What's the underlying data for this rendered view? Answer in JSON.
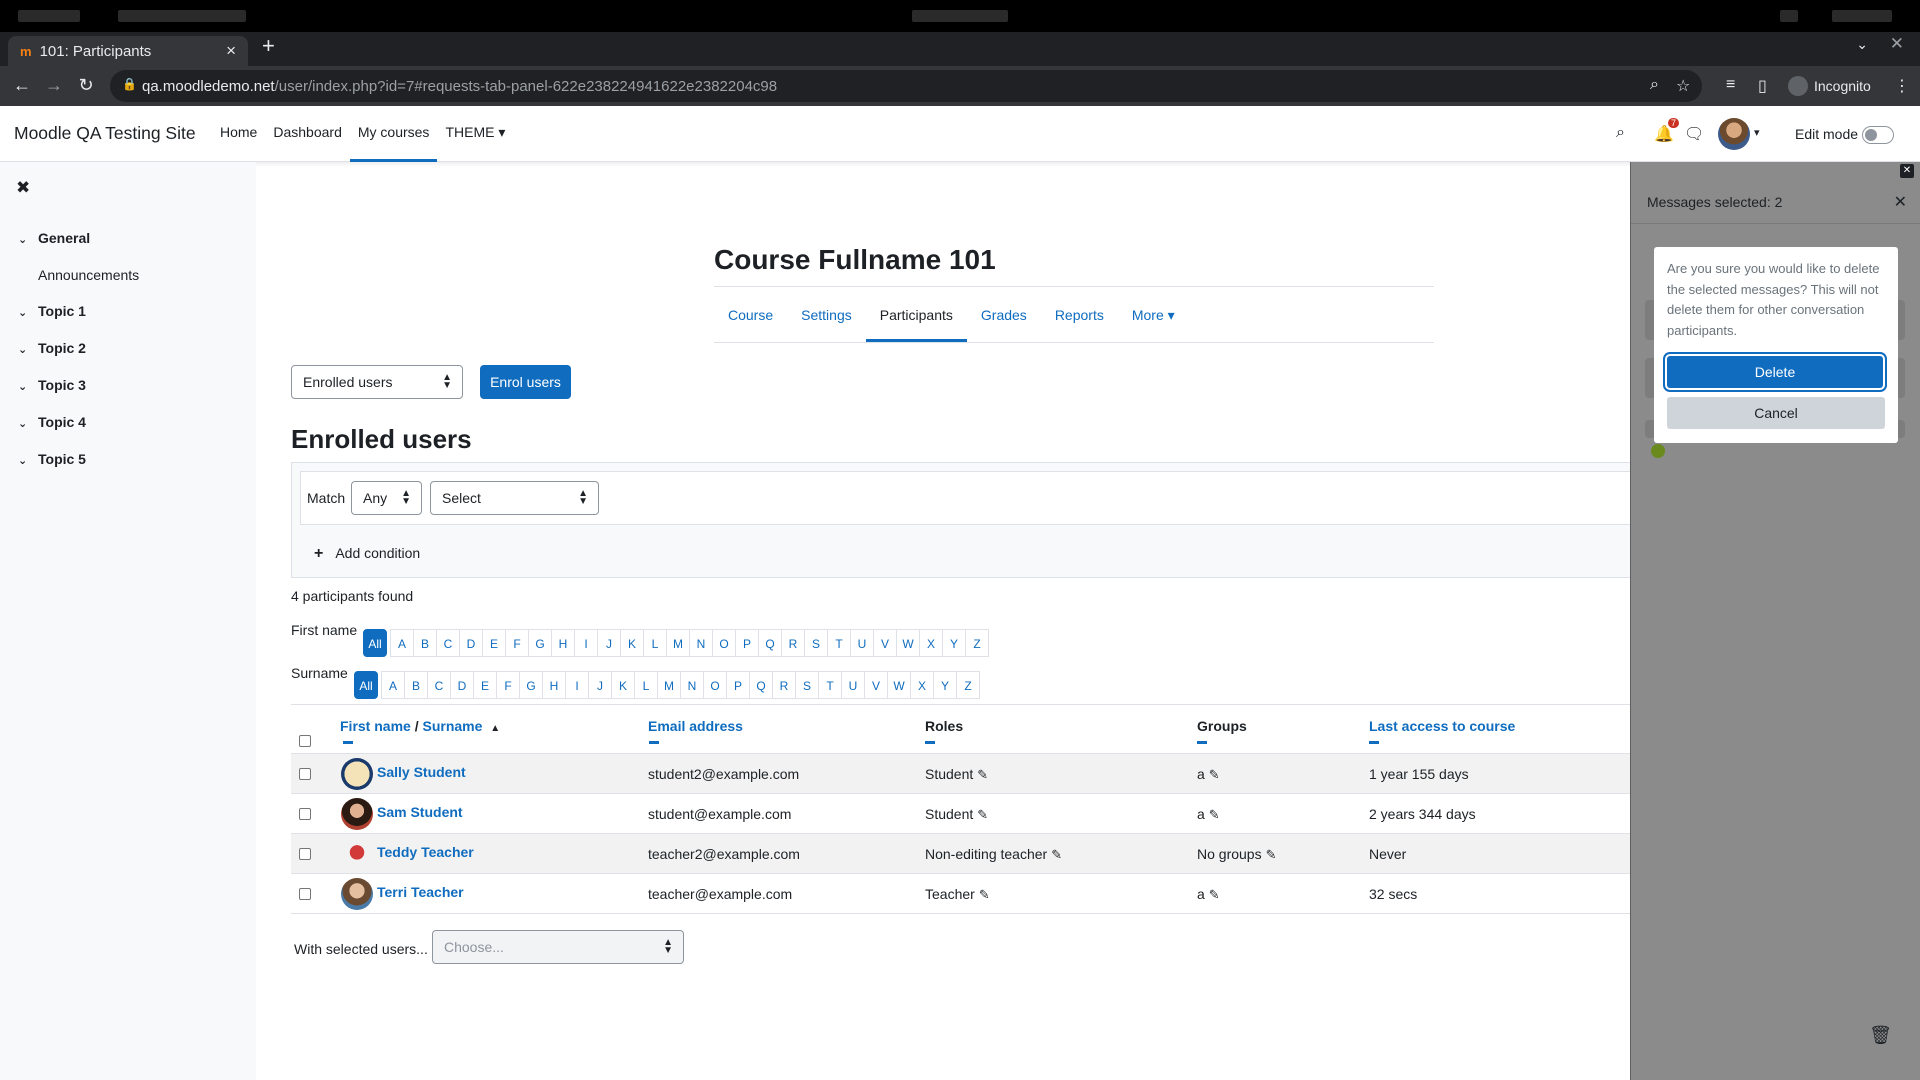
{
  "browser": {
    "tab_title": "101: Participants",
    "favicon": "m",
    "url_host": "qa.moodledemo.net",
    "url_path": "/user/index.php?id=7#requests-tab-panel-622e238224941622e2382204c98",
    "profile_label": "Incognito"
  },
  "navbar": {
    "site_name": "Moodle QA Testing Site",
    "links": [
      "Home",
      "Dashboard",
      "My courses",
      "THEME ▾"
    ],
    "notification_count": "7",
    "edit_mode_label": "Edit mode"
  },
  "course_index": {
    "sections": [
      "General",
      "Topic 1",
      "Topic 2",
      "Topic 3",
      "Topic 4",
      "Topic 5"
    ],
    "activities": [
      "Announcements"
    ]
  },
  "course": {
    "title": "Course Fullname 101",
    "tabs": [
      "Course",
      "Settings",
      "Participants",
      "Grades",
      "Reports",
      "More ▾"
    ]
  },
  "participants_page": {
    "selector_value": "Enrolled users",
    "enrol_button": "Enrol users",
    "heading": "Enrolled users",
    "match_label": "Match",
    "match_value": "Any",
    "filter_type_value": "Select",
    "add_condition": "Add condition",
    "found_text": "4 participants found",
    "first_name_label": "First name",
    "surname_label": "Surname",
    "all_label": "All",
    "letters": [
      "A",
      "B",
      "C",
      "D",
      "E",
      "F",
      "G",
      "H",
      "I",
      "J",
      "K",
      "L",
      "M",
      "N",
      "O",
      "P",
      "Q",
      "R",
      "S",
      "T",
      "U",
      "V",
      "W",
      "X",
      "Y",
      "Z"
    ],
    "columns": {
      "first_name": "First name",
      "separator": " / ",
      "surname": "Surname",
      "email": "Email address",
      "roles": "Roles",
      "groups": "Groups",
      "last_access": "Last access to course"
    },
    "rows": [
      {
        "name": "Sally Student",
        "email": "student2@example.com",
        "role": "Student",
        "group": "a",
        "last_access": "1 year 155 days"
      },
      {
        "name": "Sam Student",
        "email": "student@example.com",
        "role": "Student",
        "group": "a",
        "last_access": "2 years 344 days"
      },
      {
        "name": "Teddy Teacher",
        "email": "teacher2@example.com",
        "role": "Non-editing teacher",
        "group": "No groups",
        "last_access": "Never"
      },
      {
        "name": "Terri Teacher",
        "email": "teacher@example.com",
        "role": "Teacher",
        "group": "a",
        "last_access": "32 secs"
      }
    ],
    "with_selected_label": "With selected users...",
    "with_selected_placeholder": "Choose..."
  },
  "messages_drawer": {
    "selected_text": "Messages selected: 2",
    "confirm_text": "Are you sure you would like to delete the selected messages? This will not delete them for other conversation participants.",
    "delete_button": "Delete",
    "cancel_button": "Cancel"
  },
  "colors": {
    "primary": "#0f6cbf",
    "text": "#1d2125",
    "drawer_overlay": "#8b8b8b",
    "badge": "#ca3120"
  }
}
